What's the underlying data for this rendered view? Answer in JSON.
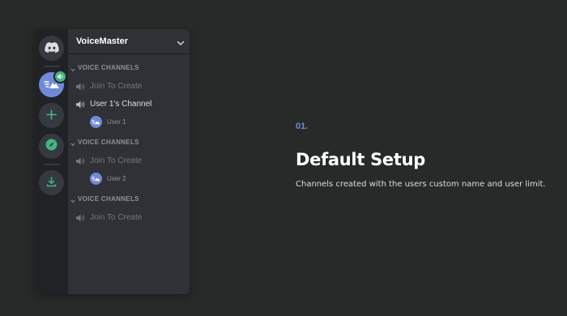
{
  "server": {
    "name": "VoiceMaster"
  },
  "rail": {
    "items": [
      {
        "icon": "discord-logo-icon"
      },
      {
        "icon": "server-avatar-icon",
        "active": true,
        "badge": "speaker-icon"
      },
      {
        "icon": "add-server-icon"
      },
      {
        "icon": "explore-compass-icon"
      },
      {
        "icon": "download-icon"
      }
    ]
  },
  "channel_groups": [
    {
      "category": "VOICE CHANNELS",
      "channels": [
        {
          "label": "Join To Create",
          "members": []
        },
        {
          "label": "User 1's Channel",
          "members": [
            "User 1"
          ]
        }
      ]
    },
    {
      "category": "VOICE CHANNELS",
      "channels": [
        {
          "label": "Join To Create",
          "members": [
            "User 2"
          ]
        }
      ]
    },
    {
      "category": "VOICE CHANNELS",
      "channels": [
        {
          "label": "Join To Create",
          "members": []
        }
      ]
    }
  ],
  "feature": {
    "step": "01.",
    "title": "Default Setup",
    "description": "Channels created with the users custom name and user limit."
  },
  "colors": {
    "background": "#282929",
    "accent": "#7289da",
    "green": "#43b581",
    "rail": "#202225",
    "panel": "#2f3136"
  }
}
